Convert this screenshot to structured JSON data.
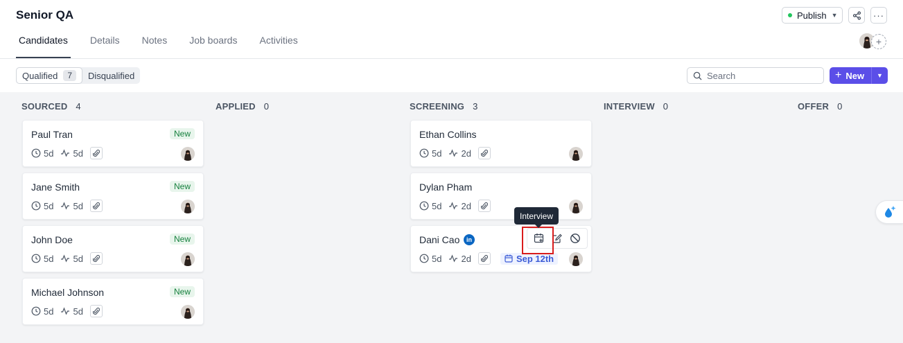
{
  "header": {
    "title": "Senior QA",
    "tabs": [
      {
        "label": "Candidates",
        "active": true
      },
      {
        "label": "Details",
        "active": false
      },
      {
        "label": "Notes",
        "active": false
      },
      {
        "label": "Job boards",
        "active": false
      },
      {
        "label": "Activities",
        "active": false
      }
    ],
    "publish_label": "Publish",
    "publish_status_color": "#22c55e",
    "share_icon": "share-icon",
    "more_icon": "more-icon"
  },
  "toolbar": {
    "filters": [
      {
        "label": "Qualified",
        "count": "7",
        "active": true
      },
      {
        "label": "Disqualified",
        "active": false
      }
    ],
    "search_placeholder": "Search",
    "new_label": "New",
    "accent_color": "#5b4ee8"
  },
  "board": {
    "columns": [
      {
        "title": "SOURCED",
        "count": "4",
        "cards": [
          {
            "name": "Paul Tran",
            "badge": "New",
            "time_in_stage": "5d",
            "last_activity": "5d"
          },
          {
            "name": "Jane Smith",
            "badge": "New",
            "time_in_stage": "5d",
            "last_activity": "5d"
          },
          {
            "name": "John Doe",
            "badge": "New",
            "time_in_stage": "5d",
            "last_activity": "5d"
          },
          {
            "name": "Michael Johnson",
            "badge": "New",
            "time_in_stage": "5d",
            "last_activity": "5d"
          }
        ]
      },
      {
        "title": "APPLIED",
        "count": "0",
        "cards": []
      },
      {
        "title": "SCREENING",
        "count": "3",
        "cards": [
          {
            "name": "Ethan Collins",
            "time_in_stage": "5d",
            "last_activity": "2d"
          },
          {
            "name": "Dylan Pham",
            "time_in_stage": "5d",
            "last_activity": "2d"
          },
          {
            "name": "Dani Cao",
            "linkedin": "in",
            "time_in_stage": "5d",
            "last_activity": "2d",
            "scheduled": "Sep 12th"
          }
        ]
      },
      {
        "title": "INTERVIEW",
        "count": "0",
        "cards": []
      },
      {
        "title": "OFFER",
        "count": "0",
        "cards": []
      }
    ]
  },
  "hover": {
    "tooltip": "Interview",
    "actions": [
      "calendar-plus-icon",
      "edit-note-icon",
      "disqualify-icon"
    ]
  }
}
